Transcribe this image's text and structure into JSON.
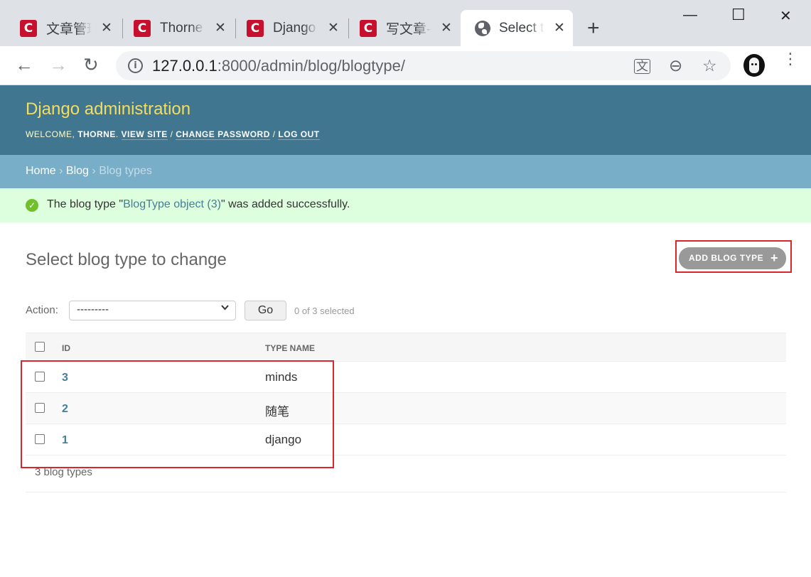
{
  "browser": {
    "tabs": [
      {
        "title": "文章管理",
        "icon": "csdn-favicon",
        "active": false
      },
      {
        "title": "Thorne",
        "icon": "csdn-favicon",
        "active": false
      },
      {
        "title": "Django",
        "icon": "csdn-favicon",
        "active": false
      },
      {
        "title": "写文章-",
        "icon": "csdn-favicon",
        "active": false
      },
      {
        "title": "Select t",
        "icon": "globe-icon",
        "active": true
      }
    ],
    "favicon_letter": "C",
    "close_glyph": "✕",
    "new_tab_glyph": "+",
    "window_controls": {
      "minimize": "—",
      "maximize": "☐",
      "close": "✕"
    },
    "nav": {
      "back": "←",
      "forward": "→",
      "reload": "↻"
    },
    "url_host": "127.0.0.1",
    "url_rest": ":8000/admin/blog/blogtype/",
    "omnibox_icons": {
      "info": "i",
      "translate": "文",
      "zoom": "⊖",
      "bookmark": "☆"
    },
    "menu": "⋮"
  },
  "admin": {
    "site_name": "Django administration",
    "welcome": "Welcome,",
    "username": "Thorne",
    "links": {
      "view_site": "View site",
      "change_password": "Change password",
      "log_out": "Log out"
    },
    "separator": "/",
    "breadcrumbs": {
      "home": "Home",
      "blog": "Blog",
      "current": "Blog types",
      "sep": "›"
    },
    "message": {
      "prefix": "The blog type \"",
      "link": "BlogType object (3)",
      "suffix": "\" was added successfully.",
      "icon": "✓",
      "status_color": "#70bf2b"
    },
    "page_title": "Select blog type to change",
    "add_button": {
      "label": "Add blog type",
      "icon": "+"
    },
    "actions": {
      "label": "Action:",
      "selected_option": "---------",
      "go": "Go",
      "counter": "0 of 3 selected"
    },
    "table": {
      "headers": [
        "ID",
        "Type name"
      ],
      "rows": [
        {
          "id": "3",
          "type_name": "minds"
        },
        {
          "id": "2",
          "type_name": "随笔"
        },
        {
          "id": "1",
          "type_name": "django"
        }
      ]
    },
    "paginator": "3 blog types",
    "colors": {
      "header": "#417690",
      "breadcrumbs": "#79aec8",
      "site_name": "#f5dd5d",
      "success_bg": "#dfd",
      "link": "#447e9b",
      "annotation_red": "#d9262b"
    }
  }
}
